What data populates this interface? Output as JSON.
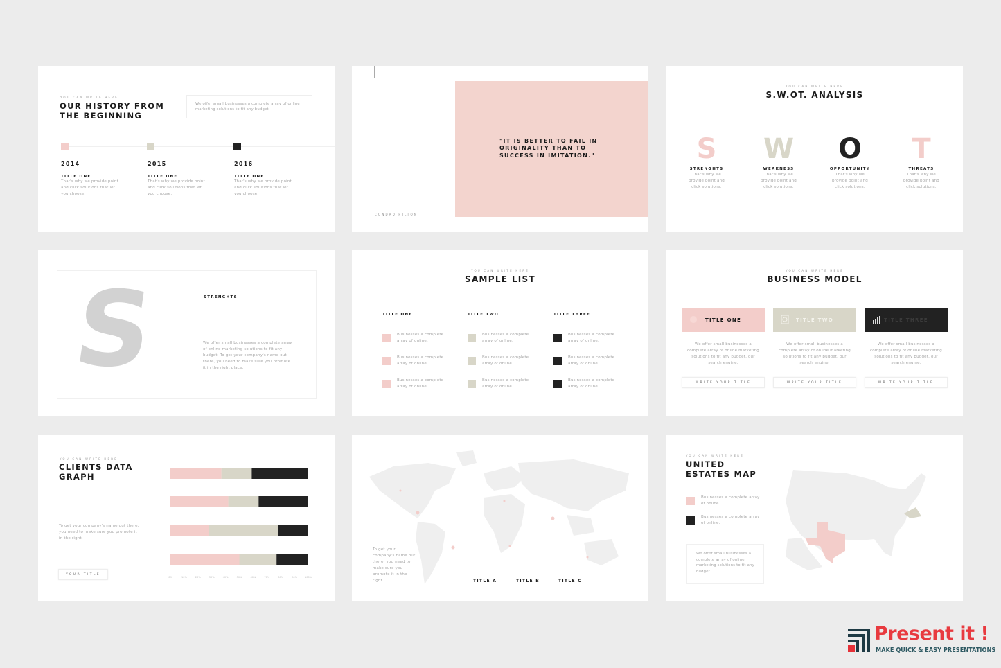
{
  "colors": {
    "pink": "#f3cdca",
    "beige": "#d8d6c8",
    "black": "#222222",
    "background": "#ececec"
  },
  "slide1": {
    "subtitle": "You can write here",
    "title": "Our history from the beginning",
    "box_text": "We offer small businesses a complete array of online marketing solutions to fit any budget.",
    "items": [
      {
        "year": "2014",
        "title": "Title one",
        "text": "That's why we provide point and click solutions that let you choose.",
        "color": "pink"
      },
      {
        "year": "2015",
        "title": "Title one",
        "text": "That's why we provide point and click solutions that let you choose.",
        "color": "beige"
      },
      {
        "year": "2016",
        "title": "Title one",
        "text": "That's why we provide point and click solutions that let you choose.",
        "color": "black"
      }
    ]
  },
  "slide2": {
    "quote": "\"It is better to fail in originality than to success in imitation.\"",
    "author": "Condad Hilton"
  },
  "slide3": {
    "subtitle": "You can write here",
    "title": "S.W.OT. Analysis",
    "items": [
      {
        "letter": "S",
        "label": "Strenghts",
        "text": "That's why we provide point and click solutions.",
        "color": "#f3cdca"
      },
      {
        "letter": "W",
        "label": "Weakness",
        "text": "That's why we provide point and click solutions.",
        "color": "#d8d6c8"
      },
      {
        "letter": "O",
        "label": "Opportunity",
        "text": "That's why we provide point and click solutions.",
        "color": "#222222"
      },
      {
        "letter": "T",
        "label": "Threats",
        "text": "That's why we provide point and click solutions.",
        "color": "#f3cdca"
      }
    ]
  },
  "slide4": {
    "letter": "S",
    "title": "Strenghts",
    "text": "We offer small businesses a complete array of online marketing solutions to fit any budget. To get your company's name out there, you need to make sure you promote it in the right place."
  },
  "slide5": {
    "subtitle": "You can write here",
    "title": "Sample list",
    "columns": [
      {
        "title": "Title one",
        "items": [
          "Businesses a complete array of online.",
          "Businesses a complete array of online.",
          "Businesses a complete array of online."
        ]
      },
      {
        "title": "Title two",
        "items": [
          "Businesses a complete array of online.",
          "Businesses a complete array of online.",
          "Businesses a complete array of online."
        ]
      },
      {
        "title": "Title three",
        "items": [
          "Businesses a complete array of online.",
          "Businesses a complete array of online.",
          "Businesses a complete array of online."
        ]
      }
    ]
  },
  "slide6": {
    "subtitle": "You can write here",
    "title": "Business model",
    "cards": [
      {
        "title": "Title one",
        "text": "We offer small businesses a complete array of online marketing solutions to fit any budget, our search engine.",
        "button": "Write your title",
        "icon": "circle-icon"
      },
      {
        "title": "Title two",
        "text": "We offer small businesses a complete array of online marketing solutions to fit any budget, our search engine.",
        "button": "Write your title",
        "icon": "clipboard-icon"
      },
      {
        "title": "Title three",
        "text": "We offer small businesses a complete array of online marketing solutions to fit any budget, our search engine.",
        "button": "Write your title",
        "icon": "bar-chart-icon"
      }
    ]
  },
  "slide7": {
    "subtitle": "You can write here",
    "title": "Clients data graph",
    "text": "To get your company's name out there, you need to make sure you promote it in the right.",
    "button": "Your title"
  },
  "chart_data": {
    "type": "bar",
    "orientation": "horizontal",
    "stacked": true,
    "xlim": [
      0,
      100
    ],
    "x_ticks": [
      "0%",
      "10%",
      "20%",
      "30%",
      "40%",
      "50%",
      "60%",
      "70%",
      "80%",
      "90%",
      "100%"
    ],
    "series": [
      {
        "color": "#f3cdca",
        "values": [
          37,
          42,
          28,
          50
        ]
      },
      {
        "color": "#d8d6c8",
        "values": [
          22,
          22,
          50,
          27
        ]
      },
      {
        "color": "#222222",
        "values": [
          41,
          36,
          22,
          23
        ]
      }
    ]
  },
  "slide8": {
    "text": "To get your company's name out there, you need to make sure you promote it in the right.",
    "titles": [
      "Title A",
      "Title B",
      "Title C"
    ]
  },
  "slide9": {
    "subtitle": "You can write here",
    "title": "United estates map",
    "legend": [
      {
        "text": "Businesses a complete array of online.",
        "color": "pink"
      },
      {
        "text": "Businesses a complete array of online.",
        "color": "black"
      }
    ],
    "box_text": "We offer small businesses a complete array of online marketing solutions to fit any budget."
  },
  "brand": {
    "name": "Present it !",
    "tagline": "MAKE QUICK & EASY PRESENTATIONS"
  }
}
